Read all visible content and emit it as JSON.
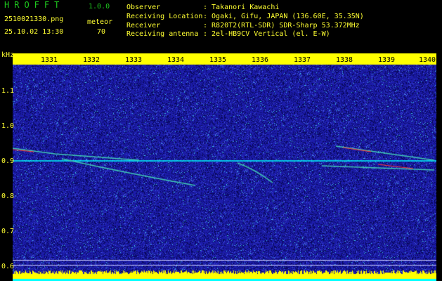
{
  "header": {
    "app_title": "HROFFT",
    "version": "1.0.0",
    "filename": "2510021330.png",
    "datetime": "25.10.02 13:30",
    "meteor_label": "meteor",
    "meteor_count": "70"
  },
  "info": [
    {
      "label": "Observer",
      "value": ": Takanori Kawachi"
    },
    {
      "label": "Receiving Location",
      "value": ": Ogaki, Gifu, JAPAN (136.60E, 35.35N)"
    },
    {
      "label": "Receiver",
      "value": ": R820T2(RTL-SDR) SDR-Sharp 53.372MHz"
    },
    {
      "label": "Receiving antenna",
      "value": ": 2el-HB9CV Vertical (el. E-W)"
    }
  ],
  "axis": {
    "unit": "kHz",
    "y_ticks": [
      "1.1",
      "1.0",
      "0.9",
      "0.8",
      "0.7",
      "0.6"
    ],
    "x_ticks": [
      "1331",
      "1332",
      "1333",
      "1334",
      "1335",
      "1336",
      "1337",
      "1338",
      "1339",
      "1340"
    ]
  },
  "colors": {
    "background": "#000000",
    "panel": "#1c1cb4",
    "header_green": "#1ec81e",
    "text_yellow": "#ffff32",
    "axis_band": "#ffff00",
    "signal_cyan": "#00ffff",
    "signal_red": "#ff3232",
    "bottom_band": "#ffff00"
  }
}
